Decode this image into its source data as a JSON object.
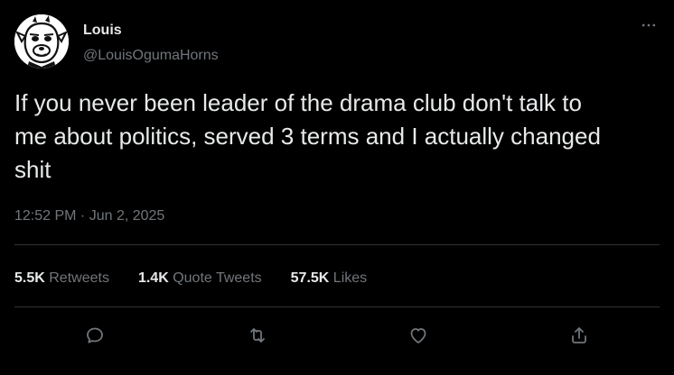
{
  "author": {
    "display_name": "Louis",
    "handle": "@LouisOgumaHorns"
  },
  "tweet": {
    "text": "If you never been leader of the drama club don't talk to\nme about politics, served 3 terms and I actually changed\nshit",
    "time": "12:52 PM",
    "separator": " · ",
    "date": "Jun 2, 2025"
  },
  "stats": {
    "retweets": {
      "count": "5.5K",
      "label": "Retweets"
    },
    "quote_tweets": {
      "count": "1.4K",
      "label": "Quote Tweets"
    },
    "likes": {
      "count": "57.5K",
      "label": "Likes"
    }
  },
  "actions": {
    "icons": [
      "reply-icon",
      "retweet-icon",
      "like-icon",
      "share-icon"
    ]
  },
  "colors": {
    "background": "#000000",
    "primary_text": "#e7e9ea",
    "secondary_text": "#71767b",
    "divider": "#2f3336"
  }
}
